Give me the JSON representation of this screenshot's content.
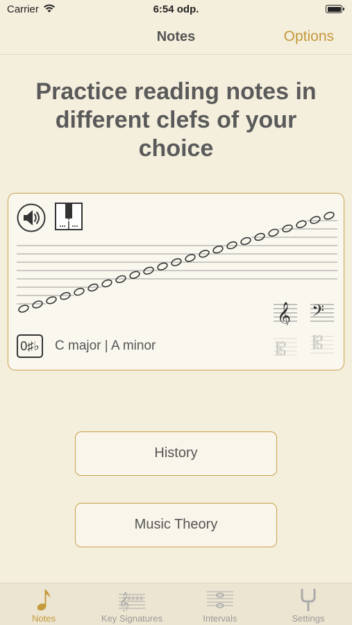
{
  "status_bar": {
    "carrier": "Carrier",
    "time": "6:54 odp."
  },
  "nav": {
    "title": "Notes",
    "options_label": "Options"
  },
  "headline": [
    "Practice reading notes in",
    "different clefs of your",
    "choice"
  ],
  "card": {
    "key_signature_symbol": "0♯♭",
    "key_signature_label": "C major | A minor"
  },
  "buttons": {
    "history": "History",
    "music_theory": "Music Theory"
  },
  "tabs": [
    {
      "label": "Notes",
      "icon": "eighth-note-icon",
      "active": true
    },
    {
      "label": "Key Signatures",
      "icon": "key-signatures-icon",
      "active": false
    },
    {
      "label": "Intervals",
      "icon": "intervals-icon",
      "active": false
    },
    {
      "label": "Settings",
      "icon": "tuning-fork-icon",
      "active": false
    }
  ],
  "colors": {
    "accent": "#c49a3c",
    "background": "#f4eedd",
    "border": "#c9a14a"
  }
}
